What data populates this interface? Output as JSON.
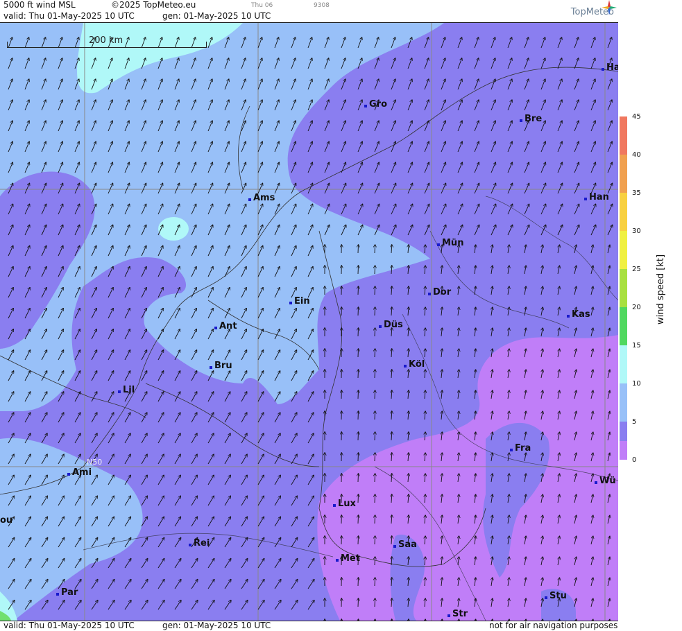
{
  "header": {
    "title": "5000 ft wind MSL",
    "copyright": "©2025 TopMeteo.eu",
    "day": "Thu 06",
    "code": "9308",
    "valid": "valid:  Thu  01-May-2025  10 UTC",
    "generated": "gen: 01-May-2025 10 UTC",
    "logo": "TopMeteo"
  },
  "footer": {
    "valid": "valid:  Thu  01-May-2025  10 UTC",
    "generated": "gen: 01-May-2025 10 UTC",
    "disclaimer": "not for air navigation purposes"
  },
  "scale_bar": "200 km",
  "parallel_label": "N50",
  "legend": {
    "label": "wind speed  [kt]",
    "ticks": [
      "45",
      "40",
      "35",
      "30",
      "25",
      "20",
      "15",
      "10",
      "5",
      "0"
    ]
  },
  "cities": [
    {
      "name": "Gro"
    },
    {
      "name": "Ha"
    },
    {
      "name": "Bre"
    },
    {
      "name": "Ams"
    },
    {
      "name": "Han"
    },
    {
      "name": "Mün"
    },
    {
      "name": "Dor"
    },
    {
      "name": "Ein"
    },
    {
      "name": "Ant"
    },
    {
      "name": "Düs"
    },
    {
      "name": "Kas"
    },
    {
      "name": "Bru"
    },
    {
      "name": "Köl"
    },
    {
      "name": "Lil"
    },
    {
      "name": "Fra"
    },
    {
      "name": "Ami"
    },
    {
      "name": "Wü"
    },
    {
      "name": "Lux"
    },
    {
      "name": "ou"
    },
    {
      "name": "Rei"
    },
    {
      "name": "Saa"
    },
    {
      "name": "Met"
    },
    {
      "name": "Par"
    },
    {
      "name": "Stu"
    },
    {
      "name": "Str"
    }
  ],
  "colors": {
    "band_0_5": "#c07ef8",
    "band_5_10": "#8a7ef0",
    "band_10_15": "#98c0f8",
    "band_15_20": "#b0f8f8",
    "band_20_25": "#70e070"
  }
}
